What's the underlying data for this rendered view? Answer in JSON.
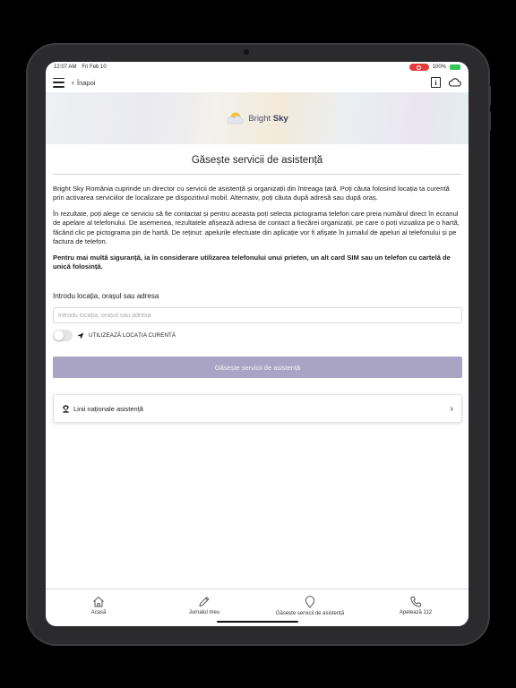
{
  "status_bar": {
    "time": "12:07 AM",
    "date": "Fri Feb 10",
    "battery": "100%"
  },
  "nav": {
    "back_label": "Înapoi"
  },
  "banner": {
    "logo_text_regular": "Bright",
    "logo_text_bold": "Sky"
  },
  "page": {
    "title": "Găsește servicii de asistență",
    "paragraph_1": "Bright Sky România cuprinde un director cu servicii de asistență și organizații din întreaga țară. Poți căuta folosind locația ta curentă prin activarea serviciilor de localizare pe dispozitivul mobil. Alternativ, poți căuta după adresă sau după oraș.",
    "paragraph_2": "În rezultate, poți alege ce serviciu să fie contactat și pentru aceasta poți selecta pictograma telefon care preia numărul direct în ecranul de apelare al telefonului. De asemenea, rezultatele afișează adresa de contact a fiecărei organizații, pe care o poți vizualiza pe o hartă, făcând clic pe pictograma pin de hartă. De reținut: apelurile efectuate din aplicație vor fi afișate în jurnalul de apeluri al telefonului și pe factura de telefon.",
    "paragraph_3": "Pentru mai multă siguranță, ia în considerare utilizarea telefonului unui prieten, un alt card SIM sau un telefon cu cartelă de unică folosință."
  },
  "search": {
    "label": "Introdu locația, orașul sau adresa",
    "placeholder": "Introdu locația, orașul sau adresa",
    "value": ""
  },
  "location_toggle": {
    "label": "UTILIZEAZĂ LOCAȚIA CURENTĂ",
    "enabled": false
  },
  "primary_button": {
    "label": "Găsește servicii de asistență"
  },
  "helplines_card": {
    "label": "Linii naționale asistență"
  },
  "tabbar": {
    "tabs": [
      {
        "label": "Acasă",
        "icon": "home-icon"
      },
      {
        "label": "Jurnalul meu",
        "icon": "pencil-icon"
      },
      {
        "label": "Găsește servicii de asistență",
        "icon": "map-pin-icon"
      },
      {
        "label": "Apelează 112",
        "icon": "phone-icon"
      }
    ]
  },
  "colors": {
    "primary_button": "#aaa4c4",
    "battery": "#34c759",
    "record_indicator": "#e63b3b"
  }
}
